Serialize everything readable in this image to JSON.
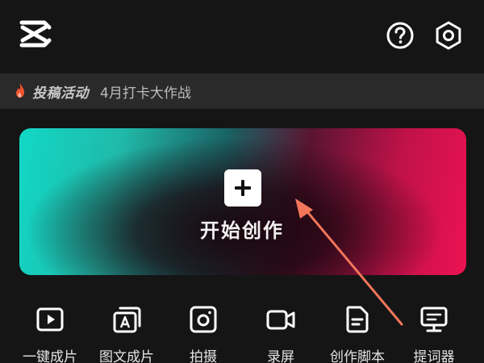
{
  "header": {
    "logo_icon": "capcut-logo",
    "help_icon": "help-icon",
    "settings_icon": "settings-icon"
  },
  "event_banner": {
    "icon": "flame-icon",
    "label": "投稿活动",
    "title": "4月打卡大作战",
    "accent_color": "#f0532f"
  },
  "create_card": {
    "label": "开始创作",
    "gradient_start": "#12d8c6",
    "gradient_end": "#ec1252"
  },
  "annotation": {
    "type": "arrow",
    "color": "#f2765a"
  },
  "tools": [
    {
      "label": "一键成片",
      "icon": "play-video-icon"
    },
    {
      "label": "图文成片",
      "icon": "text-to-video-icon"
    },
    {
      "label": "拍摄",
      "icon": "camera-icon"
    },
    {
      "label": "录屏",
      "icon": "screen-record-icon"
    },
    {
      "label": "创作脚本",
      "icon": "script-icon"
    },
    {
      "label": "提词器",
      "icon": "teleprompter-icon"
    }
  ]
}
